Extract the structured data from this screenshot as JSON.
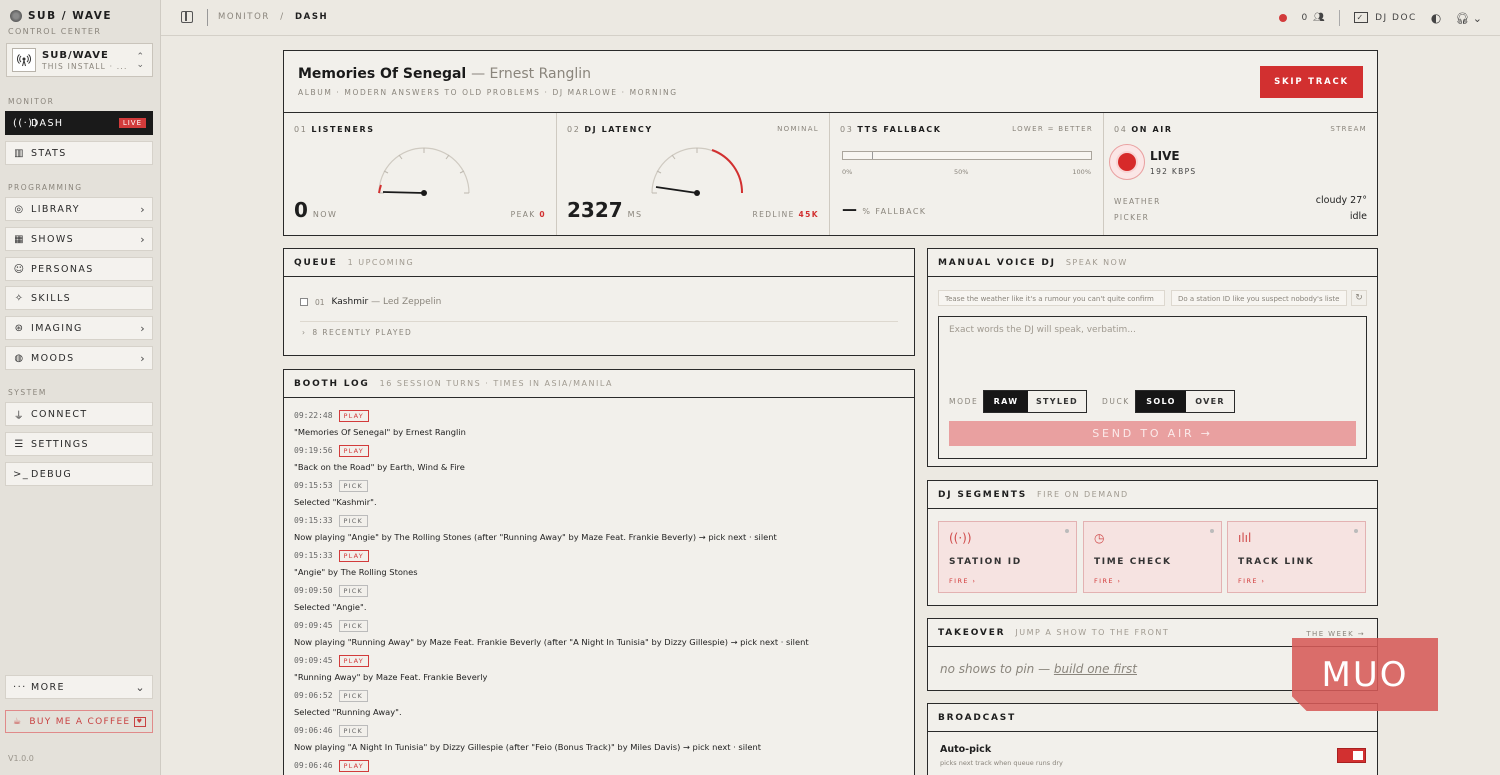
{
  "brand": {
    "name": "SUB / WAVE",
    "subtitle": "CONTROL CENTER"
  },
  "install": {
    "name": "SUB/WAVE",
    "sub": "THIS INSTALL · ..."
  },
  "sidebar": {
    "sections": {
      "monitor": "MONITOR",
      "programming": "PROGRAMMING",
      "system": "SYSTEM"
    },
    "items": [
      {
        "label": "DASH",
        "badge": "LIVE"
      },
      {
        "label": "STATS"
      },
      {
        "label": "LIBRARY"
      },
      {
        "label": "SHOWS"
      },
      {
        "label": "PERSONAS"
      },
      {
        "label": "SKILLS"
      },
      {
        "label": "IMAGING"
      },
      {
        "label": "MOODS"
      },
      {
        "label": "CONNECT"
      },
      {
        "label": "SETTINGS"
      },
      {
        "label": "DEBUG"
      }
    ],
    "more": "MORE",
    "coffee": "BUY ME A COFFEE",
    "version": "V1.0.0"
  },
  "topbar": {
    "crumb_parent": "MONITOR",
    "crumb_current": "DASH",
    "listeners": "0",
    "doc": "DJ DOC"
  },
  "now_playing": {
    "title": "Memories Of Senegal",
    "artist": "— Ernest Ranglin",
    "meta": "ALBUM · MODERN ANSWERS TO OLD PROBLEMS · DJ MARLOWE · MORNING",
    "skip": "SKIP TRACK"
  },
  "stats": {
    "listeners": {
      "num": "01",
      "label": "LISTENERS",
      "value": "0",
      "unit": "NOW",
      "peak_label": "PEAK",
      "peak": "0"
    },
    "latency": {
      "num": "02",
      "label": "DJ LATENCY",
      "status": "NOMINAL",
      "value": "2327",
      "unit": "MS",
      "redline_label": "REDLINE",
      "redline": "45K"
    },
    "tts": {
      "num": "03",
      "label": "TTS FALLBACK",
      "hint": "LOWER = BETTER",
      "scale": [
        "0%",
        "50%",
        "100%"
      ],
      "fallback_label": "% FALLBACK",
      "fallback_value": "—"
    },
    "onair": {
      "num": "04",
      "label": "ON AIR",
      "tag": "STREAM",
      "status": "LIVE",
      "bitrate": "192 KBPS",
      "weather_label": "WEATHER",
      "weather": "cloudy 27°",
      "picker_label": "PICKER",
      "picker": "idle"
    }
  },
  "queue": {
    "title": "QUEUE",
    "count": "1 UPCOMING",
    "items": [
      {
        "num": "01",
        "track": "Kashmir",
        "artist": "— Led Zeppelin"
      }
    ],
    "recent": "8 RECENTLY PLAYED"
  },
  "booth_log": {
    "title": "BOOTH LOG",
    "sub": "16 SESSION TURNS · TIMES IN ASIA/MANILA",
    "entries": [
      {
        "time": "09:22:48",
        "tag": "PLAY",
        "text": "\"Memories Of Senegal\" by Ernest Ranglin"
      },
      {
        "time": "09:19:56",
        "tag": "PLAY",
        "text": "\"Back on the Road\" by Earth, Wind & Fire"
      },
      {
        "time": "09:15:53",
        "tag": "PICK",
        "text": "Selected \"Kashmir\"."
      },
      {
        "time": "09:15:33",
        "tag": "PICK",
        "text": "Now playing \"Angie\" by The Rolling Stones (after \"Running Away\" by Maze Feat. Frankie Beverly) → pick next · silent"
      },
      {
        "time": "09:15:33",
        "tag": "PLAY",
        "text": "\"Angie\" by The Rolling Stones"
      },
      {
        "time": "09:09:50",
        "tag": "PICK",
        "text": "Selected \"Angie\"."
      },
      {
        "time": "09:09:45",
        "tag": "PICK",
        "text": "Now playing \"Running Away\" by Maze Feat. Frankie Beverly (after \"A Night In Tunisia\" by Dizzy Gillespie) → pick next · silent"
      },
      {
        "time": "09:09:45",
        "tag": "PLAY",
        "text": "\"Running Away\" by Maze Feat. Frankie Beverly"
      },
      {
        "time": "09:06:52",
        "tag": "PICK",
        "text": "Selected \"Running Away\"."
      },
      {
        "time": "09:06:46",
        "tag": "PICK",
        "text": "Now playing \"A Night In Tunisia\" by Dizzy Gillespie (after \"Feio (Bonus Track)\" by Miles Davis) → pick next · silent"
      },
      {
        "time": "09:06:46",
        "tag": "PLAY",
        "text": ""
      }
    ]
  },
  "voice_dj": {
    "title": "MANUAL VOICE DJ",
    "sub": "SPEAK NOW",
    "chips": [
      "Tease the weather like it's a rumour you can't quite confirm",
      "Do a station ID like you suspect nobody's liste"
    ],
    "placeholder": "Exact words the DJ will speak, verbatim...",
    "mode_label": "MODE",
    "mode_options": [
      "RAW",
      "STYLED"
    ],
    "duck_label": "DUCK",
    "duck_options": [
      "SOLO",
      "OVER"
    ],
    "send": "SEND TO AIR →"
  },
  "segments": {
    "title": "DJ SEGMENTS",
    "sub": "FIRE ON DEMAND",
    "cards": [
      {
        "label": "STATION ID",
        "fire": "FIRE ›",
        "icon": "broadcast-icon"
      },
      {
        "label": "TIME CHECK",
        "fire": "FIRE ›",
        "icon": "clock-icon"
      },
      {
        "label": "TRACK LINK",
        "fire": "FIRE ›",
        "icon": "waveform-icon"
      }
    ]
  },
  "takeover": {
    "title": "TAKEOVER",
    "sub": "JUMP A SHOW TO THE FRONT",
    "link": "THE WEEK →",
    "empty": "no shows to pin — ",
    "empty_link": "build one first"
  },
  "broadcast": {
    "title": "BROADCAST",
    "autopick": "Auto-pick",
    "autopick_sub": "picks next track when queue runs dry",
    "autopick_on": true
  },
  "watermark": "MUO",
  "colors": {
    "accent": "#d23030",
    "ink": "#1e1e1e",
    "paper": "#f2f0eb",
    "muted": "#8a857c"
  }
}
